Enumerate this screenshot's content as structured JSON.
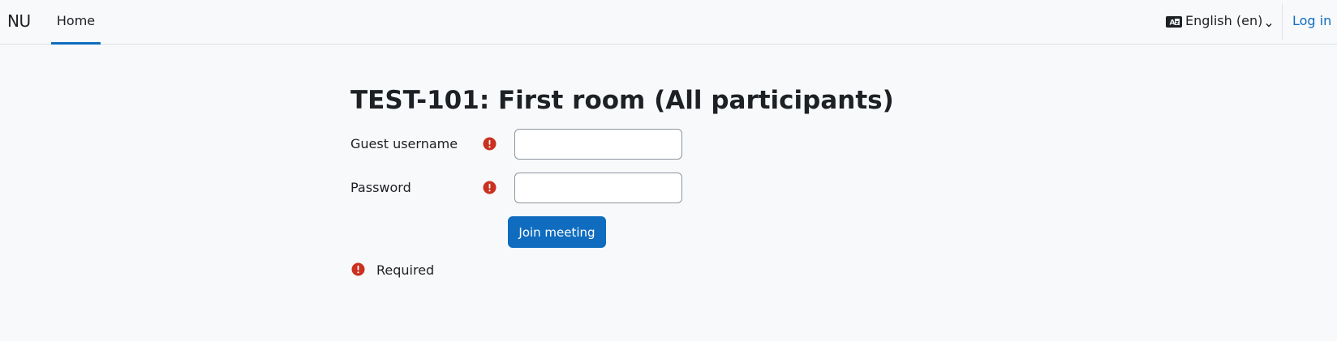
{
  "navbar": {
    "brand": "NU",
    "home_label": "Home",
    "language_label": "English (en)",
    "language_icon": "language-icon",
    "login_label": "Log in"
  },
  "main": {
    "title": "TEST-101: First room (All participants)",
    "fields": [
      {
        "label": "Guest username",
        "value": "",
        "required_icon": "required-icon"
      },
      {
        "label": "Password",
        "value": "",
        "required_icon": "required-icon"
      }
    ],
    "submit_label": "Join meeting",
    "required_note": "Required"
  },
  "colors": {
    "accent": "#0f6cbf",
    "required": "#ca3120",
    "background": "#f8f9fa"
  }
}
